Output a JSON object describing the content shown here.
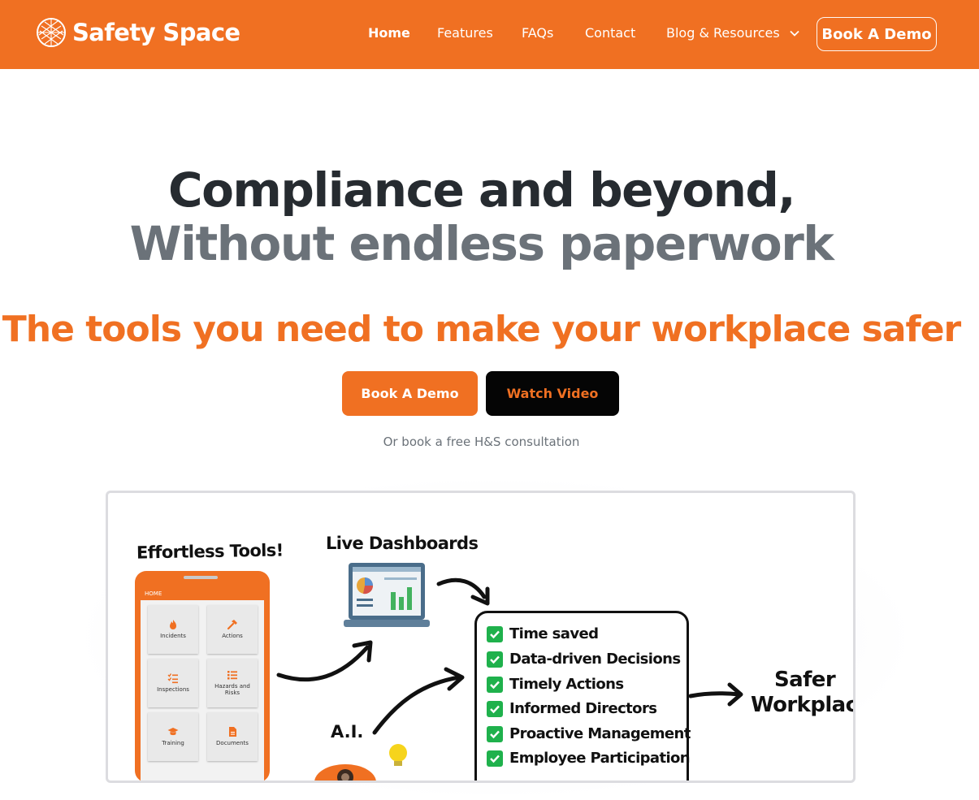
{
  "nav": {
    "brand": "Safety Space",
    "links": {
      "home": "Home",
      "features": "Features",
      "faqs": "FAQs",
      "contact": "Contact",
      "blog": "Blog & Resources"
    },
    "cta": "Book A Demo"
  },
  "hero": {
    "line1": "Compliance and beyond,",
    "line2": "Without endless paperwork",
    "subhead": "The tools you need to make your workplace safer",
    "primary_button": "Book A Demo",
    "secondary_button": "Watch Video",
    "consultation": "Or book a free H&S consultation"
  },
  "illustration": {
    "tools_title": "Effortless Tools!",
    "dashboards_title": "Live Dashboards",
    "ai_label": "A.I.",
    "phone": {
      "header": "HOME",
      "tiles": [
        {
          "label": "Incidents",
          "icon": "flame-icon"
        },
        {
          "label": "Actions",
          "icon": "hammer-icon"
        },
        {
          "label": "Inspections",
          "icon": "checklist-icon"
        },
        {
          "label": "Hazards and Risks",
          "icon": "list-icon"
        },
        {
          "label": "Training",
          "icon": "graduation-cap-icon"
        },
        {
          "label": "Documents",
          "icon": "document-icon"
        }
      ]
    },
    "benefits": [
      "Time saved",
      "Data-driven Decisions",
      "Timely Actions",
      "Informed Directors",
      "Proactive Management",
      "Employee Participation"
    ],
    "outcome_line1": "Safer",
    "outcome_line2": "Workplace"
  },
  "colors": {
    "brand": "#f07022",
    "dark": "#262b30",
    "muted": "#6b7279",
    "check": "#1fb14c"
  }
}
